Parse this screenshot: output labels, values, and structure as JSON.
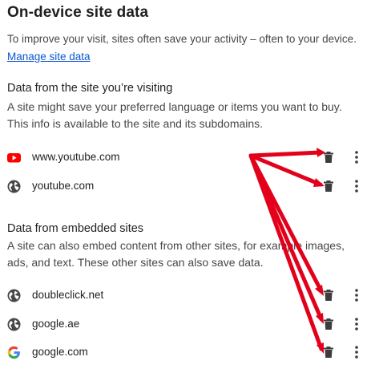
{
  "header": {
    "title": "On-device site data",
    "intro": "To improve your visit, sites often save your activity – often to your device.",
    "manage_link": "Manage site data"
  },
  "visited": {
    "heading": "Data from the site you’re visiting",
    "desc_lines": [
      "A site might save your preferred language or items you want to buy.",
      "This info is available to the site and its subdomains."
    ],
    "sites": [
      {
        "name": "www.youtube.com",
        "icon": "youtube-icon"
      },
      {
        "name": "youtube.com",
        "icon": "globe-icon"
      }
    ]
  },
  "embedded": {
    "heading": "Data from embedded sites",
    "desc_lines": [
      "A site can also embed content from other sites, for example images,",
      "ads, and text. These other sites can also save data."
    ],
    "sites": [
      {
        "name": "doubleclick.net",
        "icon": "globe-icon"
      },
      {
        "name": "google.ae",
        "icon": "globe-icon"
      },
      {
        "name": "google.com",
        "icon": "google-icon"
      }
    ]
  },
  "colors": {
    "link": "#0b57d0",
    "annotation_arrow": "#e3001b",
    "youtube": "#ff0000"
  }
}
